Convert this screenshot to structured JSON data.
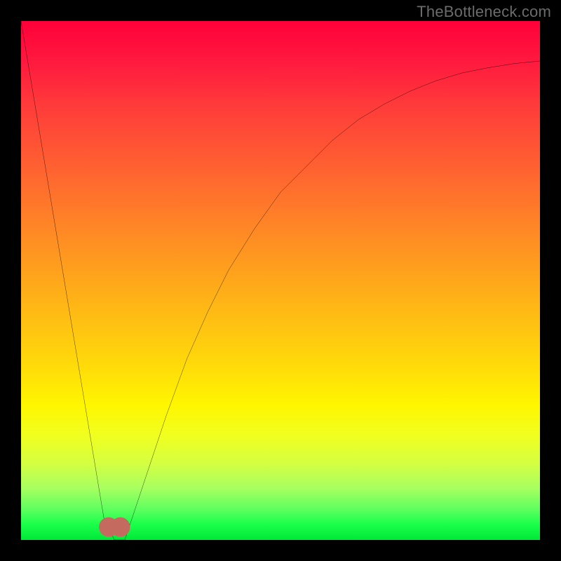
{
  "watermark": "TheBottleneck.com",
  "chart_data": {
    "type": "line",
    "title": "",
    "xlabel": "",
    "ylabel": "",
    "xlim": [
      0,
      100
    ],
    "ylim": [
      0,
      100
    ],
    "grid": false,
    "legend": false,
    "series": [
      {
        "name": "bottleneck-curve",
        "x": [
          0,
          2,
          4,
          6,
          8,
          10,
          12,
          14,
          16,
          18,
          20,
          24,
          28,
          32,
          36,
          40,
          45,
          50,
          55,
          60,
          65,
          70,
          75,
          80,
          85,
          90,
          95,
          100
        ],
        "values": [
          100,
          88,
          76,
          64,
          52,
          40,
          28,
          16,
          4,
          0,
          0,
          12,
          24,
          35,
          44,
          52,
          60,
          67,
          72,
          77,
          81,
          84,
          86.5,
          88.5,
          90,
          91,
          91.8,
          92.3
        ]
      }
    ],
    "marker": {
      "name": "optimal-zone",
      "x_range": [
        15,
        21
      ],
      "y": 2.5,
      "color": "#c46a5f"
    },
    "background_gradient": {
      "top": "#ff003a",
      "bottom": "#00e838"
    }
  }
}
